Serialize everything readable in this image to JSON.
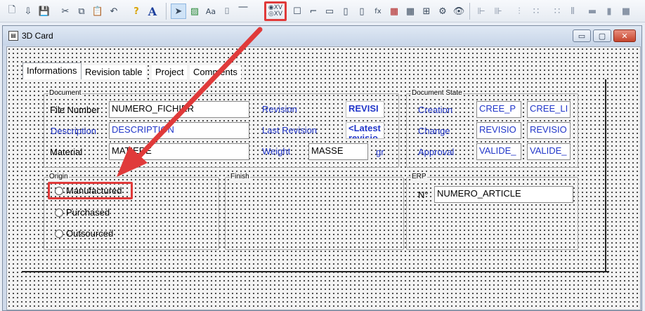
{
  "toolbar": {
    "buttons": [
      {
        "icon": "new-document-icon",
        "glyph": "🗋"
      },
      {
        "icon": "open-icon",
        "glyph": "⇩"
      },
      {
        "icon": "save-icon",
        "glyph": "💾"
      },
      {
        "icon": "cut-icon",
        "glyph": "✂"
      },
      {
        "icon": "copy-icon",
        "glyph": "⧉"
      },
      {
        "icon": "paste-icon",
        "glyph": "📋"
      },
      {
        "icon": "undo-icon",
        "glyph": "↶"
      },
      {
        "icon": "help-icon",
        "glyph": "?"
      },
      {
        "icon": "font-icon",
        "glyph": "A"
      },
      {
        "icon": "pointer-icon",
        "glyph": "➤"
      },
      {
        "icon": "image-icon",
        "glyph": "▨"
      },
      {
        "icon": "text-icon",
        "glyph": "Aa"
      },
      {
        "icon": "field-icon",
        "glyph": "⌷"
      },
      {
        "icon": "line-icon",
        "glyph": "⎺"
      },
      {
        "icon": "radio-group-icon",
        "glyph": "◉"
      },
      {
        "icon": "checkbox-icon",
        "glyph": "☐"
      },
      {
        "icon": "frame-icon",
        "glyph": "⌐"
      },
      {
        "icon": "group-box-icon",
        "glyph": "▭"
      },
      {
        "icon": "tab-control-icon",
        "glyph": "▯"
      },
      {
        "icon": "formula-icon",
        "glyph": "fx"
      },
      {
        "icon": "table-icon",
        "glyph": "▦"
      },
      {
        "icon": "tree-icon",
        "glyph": "⋮"
      },
      {
        "icon": "settings-icon",
        "glyph": "✲"
      },
      {
        "icon": "preview-icon",
        "glyph": "👁"
      }
    ],
    "glyph_radio_xv": "◉XV\n◎XV",
    "glyph_list_a": "A",
    "glyph_list_b": "▦",
    "glyph_tree": "⊞",
    "glyph_gear": "⚙",
    "align_left": "⊩",
    "align_center": "⊪",
    "align_distribute": "⊪",
    "align_v": "⫶",
    "align_h": "∷",
    "align_right": "⫴",
    "size_w": "▬",
    "size_h": "▮",
    "size_both": "■"
  },
  "window": {
    "title": "3D Card",
    "minimize": "▭",
    "maximize": "▢",
    "close": "✕"
  },
  "tabs": [
    "Informations",
    "Revision table",
    "Project",
    "Comments"
  ],
  "document_group": {
    "title": "Document",
    "file_number_label": "File Number",
    "file_number_value": "NUMERO_FICHIER",
    "description_label": "Description",
    "description_value": "DESCRIPTION",
    "material_label": "Material",
    "material_value": "MATIERE",
    "revision_label": "Revision",
    "revision_value": "REVISI",
    "last_revision_label": "Last Revision",
    "last_revision_value": "<Latest\nrevisio",
    "weight_label": "Weight",
    "weight_value": "MASSE",
    "weight_unit": "gr"
  },
  "document_state_group": {
    "title": "Document State",
    "creation_label": "Creation",
    "creation_a": "CREE_P",
    "creation_b": "CREE_LI",
    "change_label": "Change",
    "change_a": "REVISIO",
    "change_b": "REVISIO",
    "approval_label": "Approval",
    "approval_a": "VALIDE_",
    "approval_b": "VALIDE_"
  },
  "origin_group": {
    "title": "Origin",
    "options": [
      "Manufactured",
      "Purchased",
      "Outsourced"
    ]
  },
  "finish_group": {
    "title": "Finish"
  },
  "erp_group": {
    "title": "ERP",
    "number_label": "N°",
    "number_value": "NUMERO_ARTICLE"
  },
  "colors": {
    "label_blue": "#2136c9",
    "annotation_red": "#e03a3a"
  }
}
